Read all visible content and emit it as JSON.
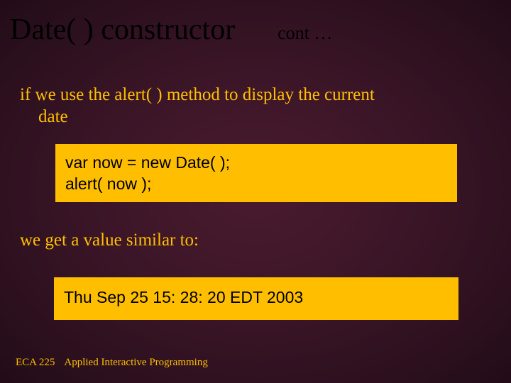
{
  "header": {
    "title": "Date( ) constructor",
    "cont": "cont …"
  },
  "paragraph1": {
    "line1": "if we use the alert( ) method to display the current",
    "line2": "date"
  },
  "code_box1": {
    "line1": "var now = new Date( );",
    "line2": "alert( now );"
  },
  "paragraph2": "we get a value similar to:",
  "code_box2": "Thu Sep 25 15: 28: 20 EDT 2003",
  "footer": {
    "course": "ECA 225",
    "subtitle": "Applied Interactive Programming"
  }
}
